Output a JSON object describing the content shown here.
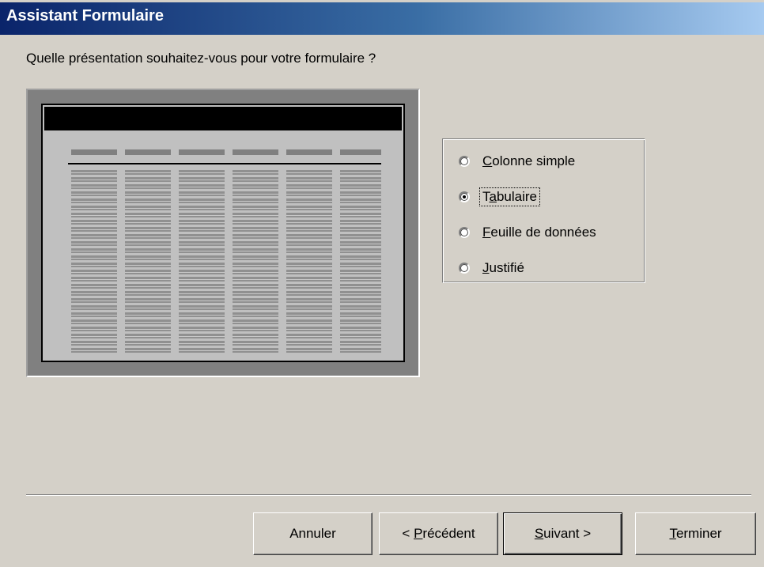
{
  "window": {
    "title": "Assistant Formulaire"
  },
  "question": "Quelle présentation souhaitez-vous pour votre formulaire ?",
  "layout_options": [
    {
      "mnemonic": "C",
      "rest": "olonne simple",
      "prefix": "",
      "checked": false
    },
    {
      "mnemonic": "a",
      "rest": "bulaire",
      "prefix": "T",
      "checked": true
    },
    {
      "mnemonic": "F",
      "rest": "euille de données",
      "prefix": "",
      "checked": false
    },
    {
      "mnemonic": "J",
      "rest": "ustifié",
      "prefix": "",
      "checked": false
    }
  ],
  "buttons": {
    "cancel": {
      "label": "Annuler"
    },
    "previous": {
      "prefix": "< ",
      "mnemonic": "P",
      "rest": "récédent"
    },
    "next": {
      "mnemonic": "S",
      "rest": "uivant >"
    },
    "finish": {
      "mnemonic": "T",
      "rest": "erminer"
    }
  },
  "colors": {
    "titlebar_start": "#0a246a",
    "titlebar_end": "#a6caf0",
    "dialog_bg": "#d4d0c8"
  }
}
